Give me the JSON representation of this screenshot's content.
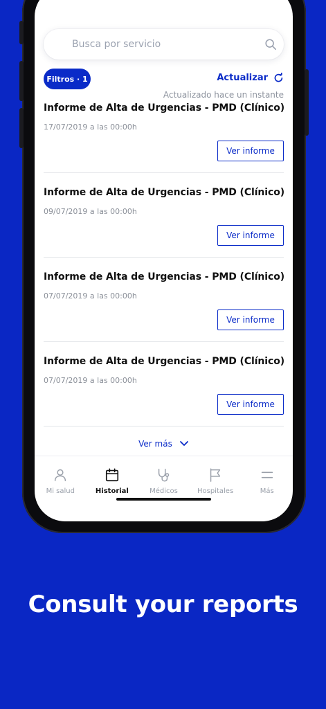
{
  "search": {
    "placeholder": "Busca por servicio"
  },
  "filters": {
    "label": "Filtros · 1"
  },
  "refresh": {
    "label": "Actualizar",
    "updated": "Actualizado hace un instante"
  },
  "reports": [
    {
      "title": "Informe de Alta de Urgencias - PMD (Clínico)",
      "date": "17/07/2019 a las 00:00h",
      "button": "Ver informe"
    },
    {
      "title": "Informe de Alta de Urgencias - PMD (Clínico)",
      "date": "09/07/2019 a las 00:00h",
      "button": "Ver informe"
    },
    {
      "title": "Informe de Alta de Urgencias - PMD (Clínico)",
      "date": "07/07/2019 a las 00:00h",
      "button": "Ver informe"
    },
    {
      "title": "Informe de Alta de Urgencias - PMD (Clínico)",
      "date": "07/07/2019 a las 00:00h",
      "button": "Ver informe"
    }
  ],
  "see_more": "Ver más",
  "tabs": [
    {
      "label": "Mi salud",
      "icon": "user-icon"
    },
    {
      "label": "Historial",
      "icon": "calendar-icon",
      "active": true
    },
    {
      "label": "Médicos",
      "icon": "stethoscope-icon"
    },
    {
      "label": "Hospitales",
      "icon": "flag-icon"
    },
    {
      "label": "Más",
      "icon": "menu-icon"
    }
  ],
  "tagline": "Consult your reports",
  "colors": {
    "brand": "#0A2BC8",
    "background": "#0A27C4"
  }
}
